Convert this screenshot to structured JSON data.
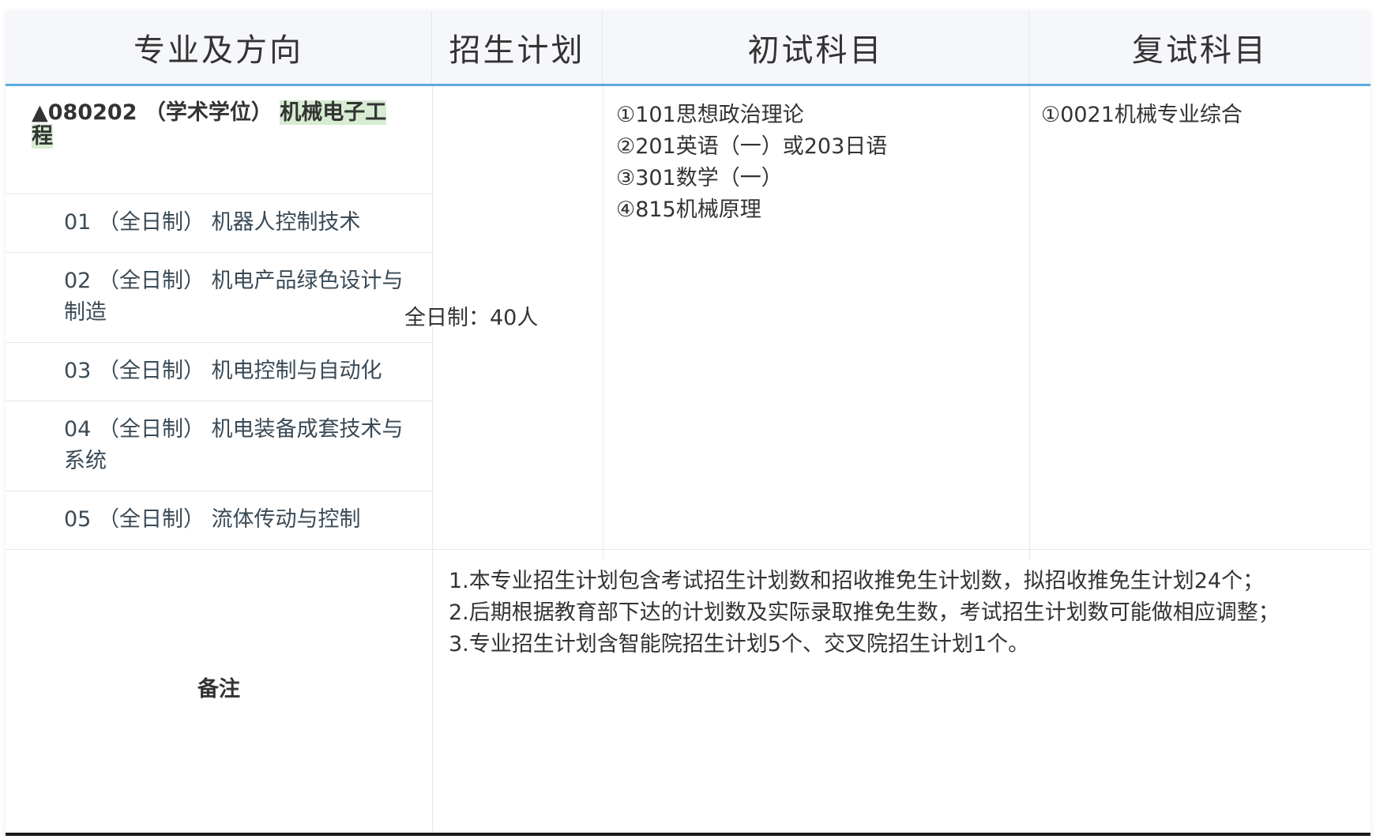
{
  "header": {
    "col1": "专业及方向",
    "col2": "招生计划",
    "col3": "初试科目",
    "col4": "复试科目"
  },
  "major": {
    "prefix": "▲080202 （学术学位） ",
    "name": "机械电子工程"
  },
  "directions": [
    "01 （全日制） 机器人控制技术",
    "02 （全日制） 机电产品绿色设计与制造",
    "03 （全日制） 机电控制与自动化",
    "04 （全日制） 机电装备成套技术与系统",
    "05 （全日制） 流体传动与控制"
  ],
  "plan": "全日制：40人",
  "exam_subjects": [
    "①101思想政治理论",
    "②201英语（一）或203日语",
    "③301数学（一）",
    "④815机械原理"
  ],
  "retest_subjects": [
    "①0021机械专业综合"
  ],
  "remarks": {
    "label": "备注",
    "items": [
      "1.本专业招生计划包含考试招生计划数和招收推免生计划数，拟招收推免生计划24个；",
      "2.后期根据教育部下达的计划数及实际录取推免生数，考试招生计划数可能做相应调整；",
      "3.专业招生计划含智能院招生计划5个、交叉院招生计划1个。"
    ]
  },
  "colors": {
    "header_bg": "#f5f7fa",
    "header_rule": "#5aa9dc",
    "highlight": "#d7ecd2",
    "grid": "#e4e8ee"
  }
}
